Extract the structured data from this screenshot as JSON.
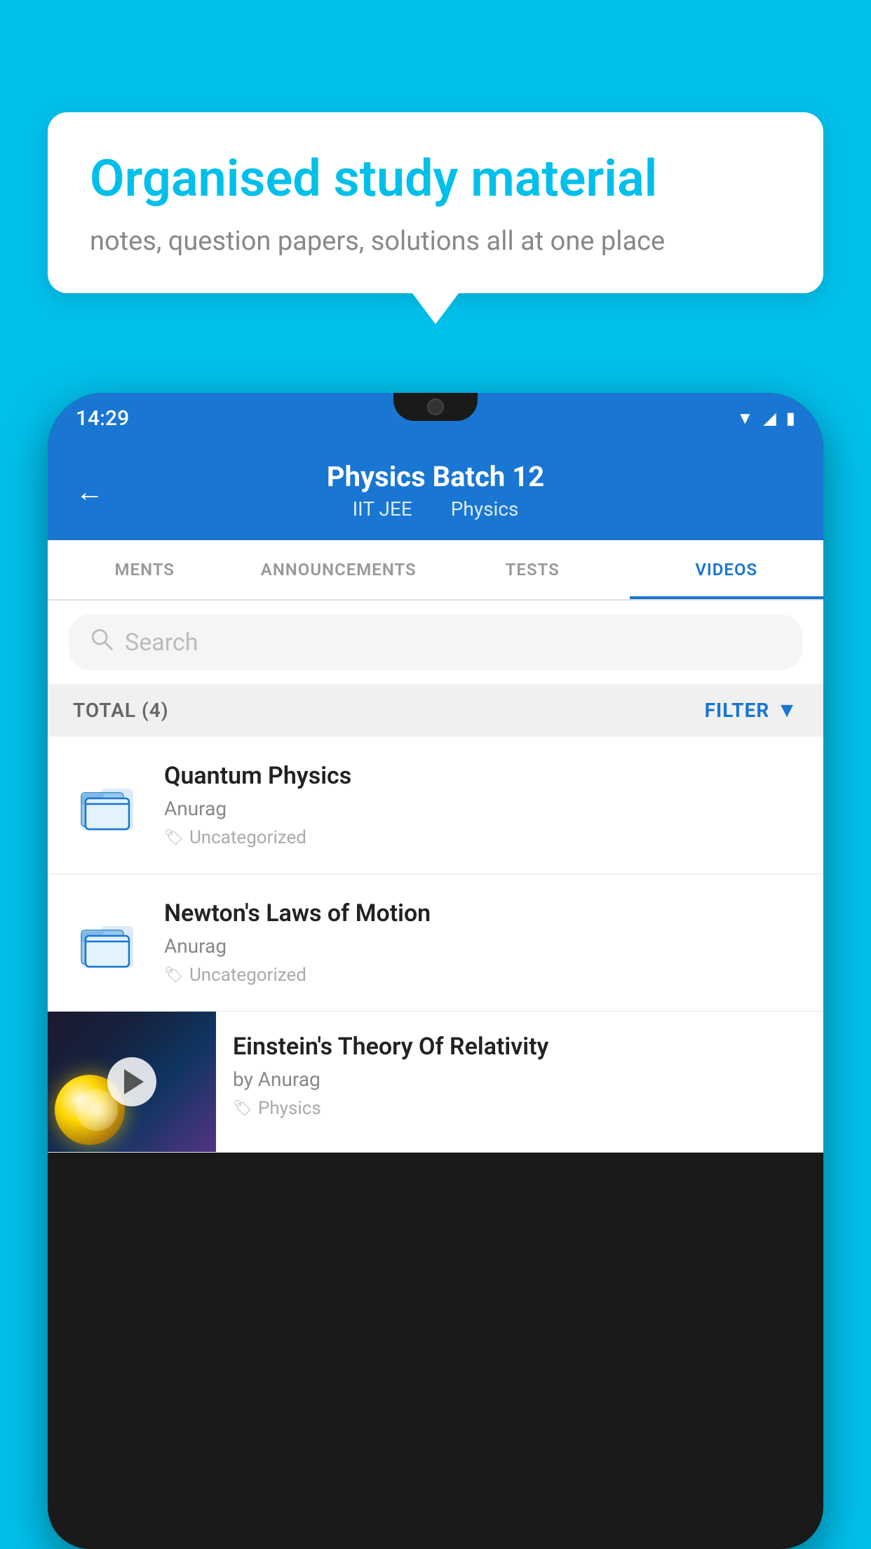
{
  "background_color": "#00BFEA",
  "bubble": {
    "title": "Organised study material",
    "subtitle": "notes, question papers, solutions all at one place"
  },
  "status_bar": {
    "time": "14:29",
    "icons": [
      "wifi",
      "signal",
      "battery"
    ]
  },
  "app_bar": {
    "title": "Physics Batch 12",
    "subtitle_parts": [
      "IIT JEE",
      "Physics"
    ],
    "back_arrow": "←"
  },
  "tabs": [
    {
      "label": "MENTS",
      "active": false
    },
    {
      "label": "ANNOUNCEMENTS",
      "active": false
    },
    {
      "label": "TESTS",
      "active": false
    },
    {
      "label": "VIDEOS",
      "active": true
    }
  ],
  "search": {
    "placeholder": "Search"
  },
  "filter_bar": {
    "total_label": "TOTAL (4)",
    "filter_label": "FILTER"
  },
  "videos": [
    {
      "id": 1,
      "title": "Quantum Physics",
      "author": "Anurag",
      "tag": "Uncategorized",
      "type": "folder"
    },
    {
      "id": 2,
      "title": "Newton's Laws of Motion",
      "author": "Anurag",
      "tag": "Uncategorized",
      "type": "folder"
    },
    {
      "id": 3,
      "title": "Einstein's Theory Of Relativity",
      "author": "by Anurag",
      "tag": "Physics",
      "type": "video"
    }
  ]
}
